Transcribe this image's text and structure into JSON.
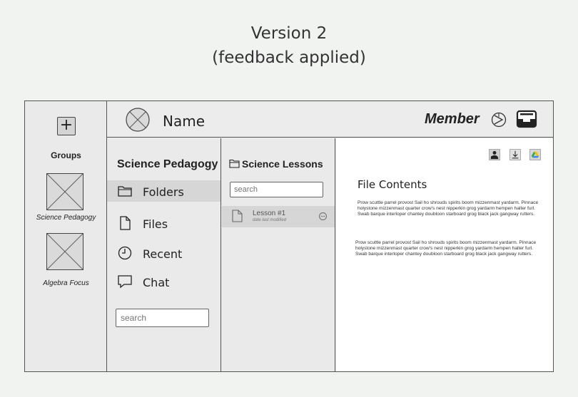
{
  "heading": {
    "line1": "Version 2",
    "line2": "(feedback applied)"
  },
  "groups": {
    "add_icon": "plus-icon",
    "add_label": "+",
    "title": "Groups",
    "items": [
      {
        "label": "Science Pedagogy",
        "icon": "placeholder-image-icon"
      },
      {
        "label": "Algebra Focus",
        "icon": "placeholder-image-icon"
      }
    ]
  },
  "topbar": {
    "avatar_icon": "avatar-placeholder-icon",
    "name": "Name",
    "role": "Member",
    "help_icon": "help-icon",
    "inbox_icon": "inbox-icon"
  },
  "nav": {
    "title": "Science Pedagogy",
    "items": [
      {
        "label": "Folders",
        "icon": "folder-icon",
        "active": true
      },
      {
        "label": "Files",
        "icon": "file-icon",
        "active": false
      },
      {
        "label": "Recent",
        "icon": "clock-icon",
        "active": false
      },
      {
        "label": "Chat",
        "icon": "chat-icon",
        "active": false
      }
    ],
    "search_placeholder": "search"
  },
  "files": {
    "title": "Science Lessons",
    "title_icon": "folder-icon",
    "search_placeholder": "search",
    "items": [
      {
        "name": "Lesson #1",
        "subtitle": "date last modified",
        "icon": "file-icon",
        "menu_icon": "more-options-icon"
      }
    ]
  },
  "content": {
    "tools": [
      "share-user-icon",
      "download-icon",
      "google-drive-icon"
    ],
    "title": "File Contents",
    "paragraph1": "Prow scuttle parrel provost Sail ho shrouds spirits boom mizzenmast yardarm. Pinnace holystone mizzenmast quarter crow's nest nipperkin grog yardarm hempen halter furl. Swab barque interloper chantey doubloon starboard grog black jack gangway rutters.",
    "paragraph2": "Prow scuttle parrel provost Sail ho shrouds spirits boom mizzenmast yardarm. Pinnace holystone mizzenmast quarter crow's nest nipperkin grog yardarm hempen halter furl. Swab barque interloper chantey doubloon starboard grog black jack gangway rutters."
  },
  "colors": {
    "page_bg": "#f1f3f1",
    "panel_bg": "#e9eae9",
    "active_bg": "#d5d6d5",
    "border": "#555555",
    "content_bg": "#ffffff",
    "drive_yellow": "#f4c20d",
    "drive_green": "#34a853",
    "drive_blue": "#4285f4"
  }
}
